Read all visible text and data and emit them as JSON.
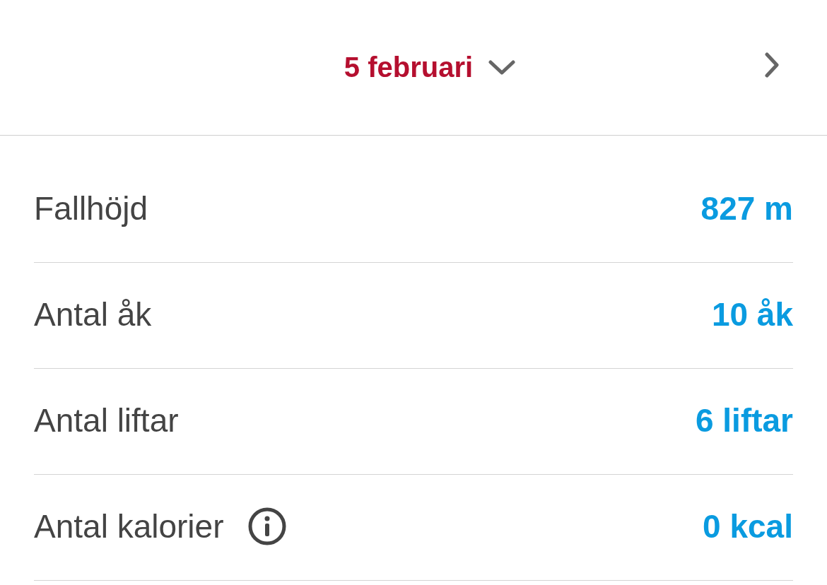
{
  "header": {
    "date": "5 februari"
  },
  "stats": [
    {
      "label": "Fallhöjd",
      "value": "827 m",
      "info_icon": false
    },
    {
      "label": "Antal åk",
      "value": "10 åk",
      "info_icon": false
    },
    {
      "label": "Antal liftar",
      "value": "6 liftar",
      "info_icon": false
    },
    {
      "label": "Antal kalorier",
      "value": "0 kcal",
      "info_icon": true
    }
  ]
}
